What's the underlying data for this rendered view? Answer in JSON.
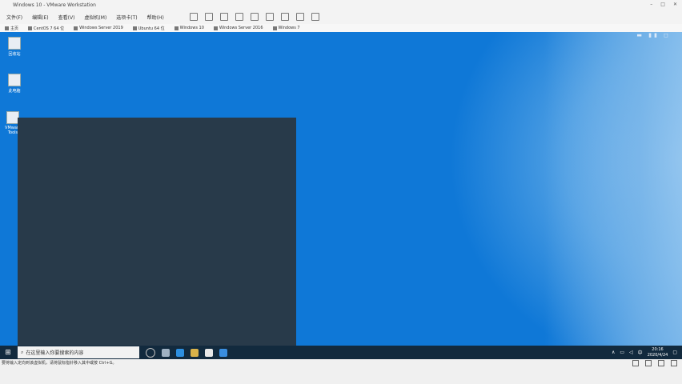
{
  "window": {
    "title": "Windows 10 - VMware Workstation",
    "controls": [
      "–",
      "□",
      "✕"
    ]
  },
  "menu": {
    "items": [
      "文件(F)",
      "编辑(E)",
      "查看(V)",
      "虚拟机(M)",
      "选项卡(T)",
      "帮助(H)"
    ]
  },
  "tabs": [
    {
      "label": "主页"
    },
    {
      "label": "CentOS 7 64 位"
    },
    {
      "label": "Windows Server 2019"
    },
    {
      "label": "Ubuntu 64 位"
    },
    {
      "label": "Windows 10"
    },
    {
      "label": "Windows Server 2016"
    },
    {
      "label": "Windows 7"
    }
  ],
  "desktop": {
    "icons": [
      {
        "label": "回收站",
        "icon": "recycle-bin-icon"
      },
      {
        "label": "此电脑",
        "icon": "this-pc-icon"
      },
      {
        "label": "VMware Tools",
        "icon": "vmware-icon"
      }
    ],
    "vm_markers": "▬ ▮▮ ◻"
  },
  "taskbar": {
    "start_glyph": "⊞",
    "search_placeholder": "在这里输入你要搜索的内容",
    "tray_lang": "中",
    "tray_indicator": "∧",
    "clock_time": "20:16",
    "clock_date": "2020/4/24"
  },
  "statusbar": {
    "message": "要将输入定向到该虚拟机，请将鼠标指针移入其中或按 Ctrl+G。"
  },
  "colors": {
    "desktop_blue": "#0f78d7",
    "taskbar": "#122a3e",
    "panel": "#283a4a"
  }
}
